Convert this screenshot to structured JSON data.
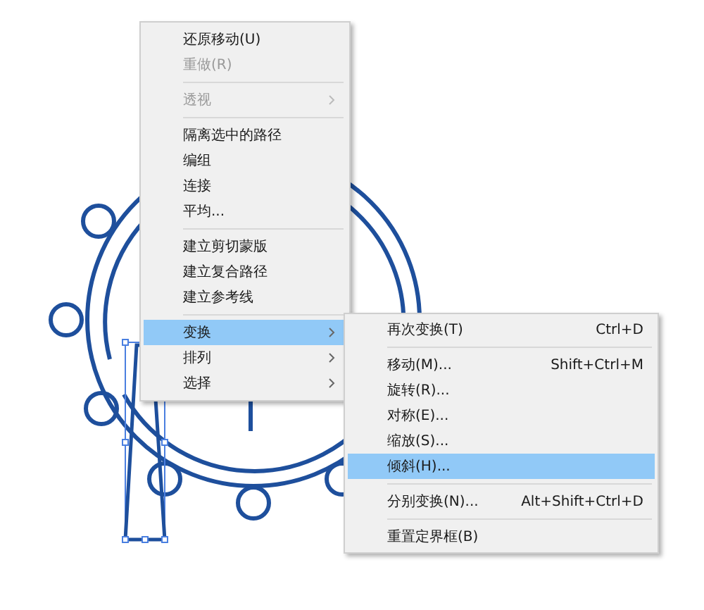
{
  "context_menu": {
    "items": [
      {
        "kind": "item",
        "label": "还原移动(U)",
        "disabled": false,
        "submenu": false,
        "selected": false
      },
      {
        "kind": "item",
        "label": "重做(R)",
        "disabled": true,
        "submenu": false,
        "selected": false
      },
      {
        "kind": "separator"
      },
      {
        "kind": "item",
        "label": "透视",
        "disabled": true,
        "submenu": true,
        "selected": false
      },
      {
        "kind": "separator"
      },
      {
        "kind": "item",
        "label": "隔离选中的路径",
        "disabled": false,
        "submenu": false,
        "selected": false
      },
      {
        "kind": "item",
        "label": "编组",
        "disabled": false,
        "submenu": false,
        "selected": false
      },
      {
        "kind": "item",
        "label": "连接",
        "disabled": false,
        "submenu": false,
        "selected": false
      },
      {
        "kind": "item",
        "label": "平均...",
        "disabled": false,
        "submenu": false,
        "selected": false
      },
      {
        "kind": "separator"
      },
      {
        "kind": "item",
        "label": "建立剪切蒙版",
        "disabled": false,
        "submenu": false,
        "selected": false
      },
      {
        "kind": "item",
        "label": "建立复合路径",
        "disabled": false,
        "submenu": false,
        "selected": false
      },
      {
        "kind": "item",
        "label": "建立参考线",
        "disabled": false,
        "submenu": false,
        "selected": false
      },
      {
        "kind": "separator"
      },
      {
        "kind": "item",
        "label": "变换",
        "disabled": false,
        "submenu": true,
        "selected": true
      },
      {
        "kind": "item",
        "label": "排列",
        "disabled": false,
        "submenu": true,
        "selected": false
      },
      {
        "kind": "item",
        "label": "选择",
        "disabled": false,
        "submenu": true,
        "selected": false
      }
    ]
  },
  "submenu": {
    "items": [
      {
        "kind": "item",
        "label": "再次变换(T)",
        "shortcut": "Ctrl+D",
        "selected": false
      },
      {
        "kind": "separator"
      },
      {
        "kind": "item",
        "label": "移动(M)...",
        "shortcut": "Shift+Ctrl+M",
        "selected": false
      },
      {
        "kind": "item",
        "label": "旋转(R)...",
        "selected": false
      },
      {
        "kind": "item",
        "label": "对称(E)...",
        "selected": false
      },
      {
        "kind": "item",
        "label": "缩放(S)...",
        "selected": false
      },
      {
        "kind": "item",
        "label": "倾斜(H)...",
        "selected": true
      },
      {
        "kind": "separator"
      },
      {
        "kind": "item",
        "label": "分别变换(N)...",
        "shortcut": "Alt+Shift+Ctrl+D",
        "selected": false
      },
      {
        "kind": "separator"
      },
      {
        "kind": "item",
        "label": "重置定界框(B)",
        "selected": false
      }
    ]
  }
}
